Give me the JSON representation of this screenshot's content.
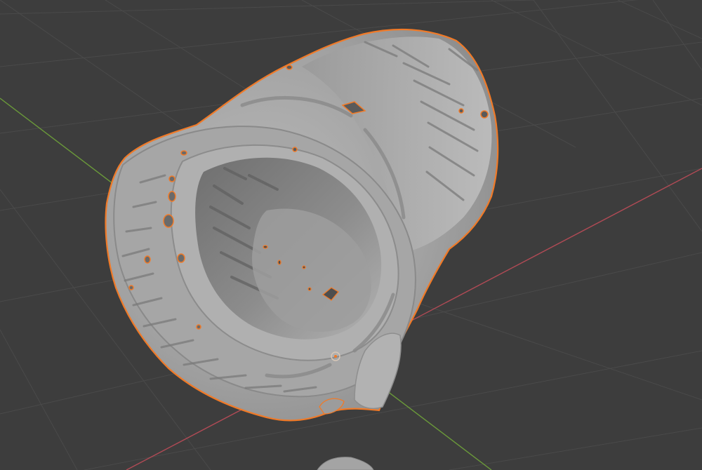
{
  "viewport": {
    "background_color": "#3d3d3d",
    "grid_color": "#4a4a4a",
    "x_axis_color": "#b04a55",
    "y_axis_color": "#6b9a3a",
    "selection_outline_color": "#f07a28",
    "mesh_color": "#a9a9a9",
    "origin_marker_color": "#d8c8b8"
  },
  "scene": {
    "object_type": "scanned cylindrical mesh",
    "selected": true,
    "origin_marker": "object-origin-icon"
  }
}
